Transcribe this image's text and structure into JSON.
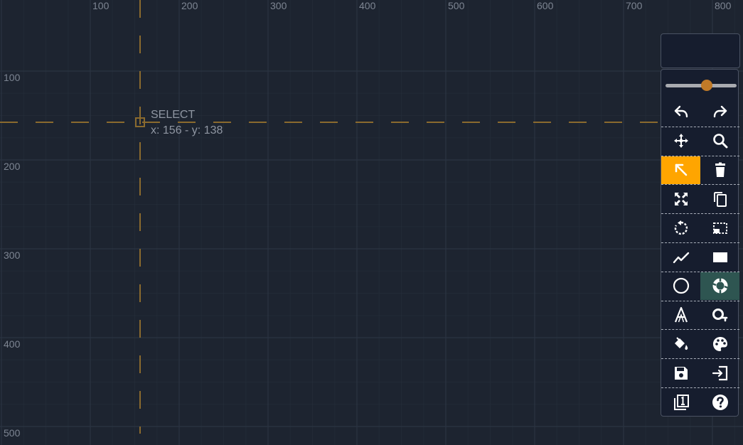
{
  "ruler": {
    "x_labels": [
      "100",
      "200",
      "300",
      "400",
      "500",
      "600",
      "700",
      "800"
    ],
    "y_labels": [
      "100",
      "200",
      "300",
      "400",
      "500"
    ]
  },
  "cursor": {
    "mode": "SELECT",
    "coords": "x: 156 - y: 138"
  },
  "colors": {
    "background": "#1d2430",
    "grid": "#262e3b",
    "crosshair": "#8a6a2e",
    "accent_active": "#ffa500",
    "accent_secondary": "#2e5551",
    "slider_thumb": "#c07a28"
  },
  "toolbar": {
    "zoom_level": 0.58,
    "tools": [
      {
        "left": "undo-icon",
        "right": "redo-icon"
      },
      {
        "left": "move-icon",
        "right": "zoom-icon"
      },
      {
        "left": "select-arrow-icon",
        "right": "trash-icon"
      },
      {
        "left": "fit-screen-icon",
        "right": "copy-icon"
      },
      {
        "left": "rotate-icon",
        "right": "selection-box-icon"
      },
      {
        "left": "line-icon",
        "right": "rectangle-icon"
      },
      {
        "left": "circle-icon",
        "right": "donut-icon"
      },
      {
        "left": "text-icon",
        "right": "search-replace-icon"
      },
      {
        "left": "fill-icon",
        "right": "palette-icon"
      },
      {
        "left": "save-icon",
        "right": "import-icon"
      },
      {
        "left": "layers-icon",
        "right": "help-icon"
      }
    ],
    "active_tool": "select-arrow-icon",
    "secondary_active_tool": "donut-icon"
  }
}
